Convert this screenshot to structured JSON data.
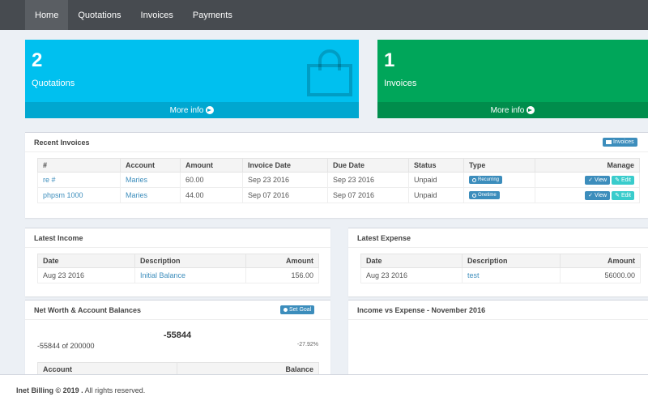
{
  "nav": {
    "items": [
      {
        "label": "Home",
        "active": true
      },
      {
        "label": "Quotations",
        "active": false
      },
      {
        "label": "Invoices",
        "active": false
      },
      {
        "label": "Payments",
        "active": false
      }
    ]
  },
  "stats": {
    "quotations": {
      "count": "2",
      "label": "Quotations",
      "more": "More info",
      "color": "#00c0ef"
    },
    "invoices": {
      "count": "1",
      "label": "Invoices",
      "more": "More info",
      "color": "#00a65a"
    }
  },
  "recent_invoices": {
    "title": "Recent Invoices",
    "button": "Invoices",
    "columns": [
      "#",
      "Account",
      "Amount",
      "Invoice Date",
      "Due Date",
      "Status",
      "Type",
      "Manage"
    ],
    "rows": [
      {
        "num": "re #",
        "account": "Maries",
        "amount": "60.00",
        "invoice_date": "Sep 23 2016",
        "due_date": "Sep 23 2016",
        "status": "Unpaid",
        "type": "Recurring",
        "view": "View",
        "edit": "Edit"
      },
      {
        "num": "phpsm 1000",
        "account": "Maries",
        "amount": "44.00",
        "invoice_date": "Sep 07 2016",
        "due_date": "Sep 07 2016",
        "status": "Unpaid",
        "type": "Onetime",
        "view": "View",
        "edit": "Edit"
      }
    ]
  },
  "latest_income": {
    "title": "Latest Income",
    "columns": [
      "Date",
      "Description",
      "Amount"
    ],
    "rows": [
      {
        "date": "Aug 23 2016",
        "description": "Initial Balance",
        "amount": "156.00"
      }
    ]
  },
  "latest_expense": {
    "title": "Latest Expense",
    "columns": [
      "Date",
      "Description",
      "Amount"
    ],
    "rows": [
      {
        "date": "Aug 23 2016",
        "description": "test",
        "amount": "56000.00"
      }
    ]
  },
  "net_worth": {
    "title": "Net Worth & Account Balances",
    "button": "Set Goal",
    "value": "-55844",
    "of_goal": "-55844 of 200000",
    "percent": "-27.92%",
    "columns": [
      "Account",
      "Balance"
    ]
  },
  "income_vs_expense": {
    "title": "Income vs Expense - November 2016"
  },
  "footer": {
    "brand": "Inet Billing © 2019 .",
    "rights": "All rights reserved."
  }
}
